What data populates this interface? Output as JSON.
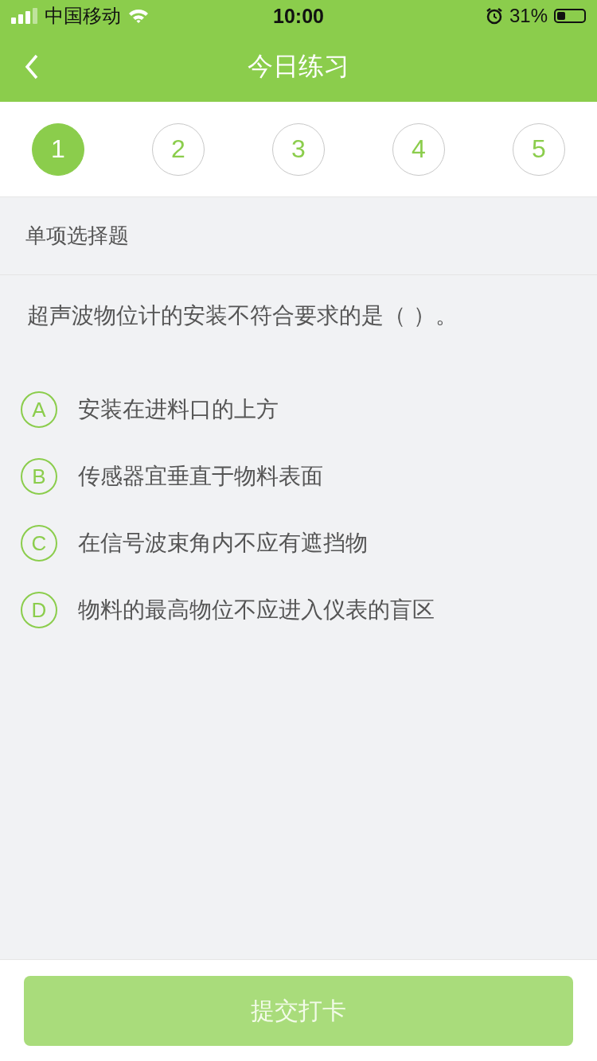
{
  "status_bar": {
    "carrier": "中国移动",
    "time": "10:00",
    "battery": "31%"
  },
  "nav": {
    "title": "今日练习"
  },
  "steps": [
    {
      "label": "1",
      "selected": true
    },
    {
      "label": "2",
      "selected": false
    },
    {
      "label": "3",
      "selected": false
    },
    {
      "label": "4",
      "selected": false
    },
    {
      "label": "5",
      "selected": false
    }
  ],
  "section_label": "单项选择题",
  "question": "超声波物位计的安装不符合要求的是（   ）。",
  "options": [
    {
      "letter": "A",
      "text": "安装在进料口的上方",
      "selected": false
    },
    {
      "letter": "B",
      "text": "传感器宜垂直于物料表面",
      "selected": false
    },
    {
      "letter": "C",
      "text": "在信号波束角内不应有遮挡物",
      "selected": false
    },
    {
      "letter": "D",
      "text": "物料的最高物位不应进入仪表的盲区",
      "selected": false
    }
  ],
  "submit": {
    "label": "提交打卡",
    "disabled": true
  }
}
